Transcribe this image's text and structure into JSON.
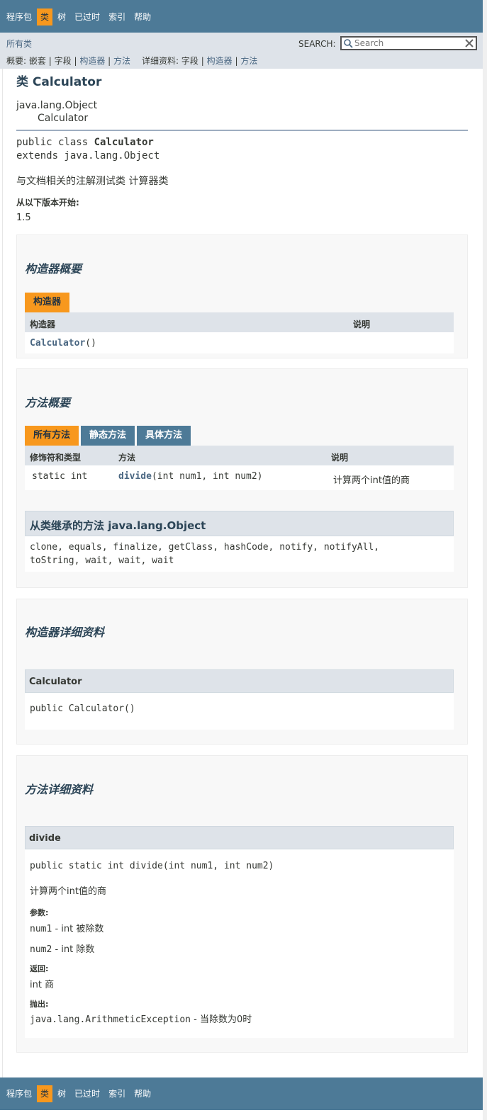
{
  "topnav": {
    "items": [
      {
        "label": "程序包",
        "active": false
      },
      {
        "label": "类",
        "active": true
      },
      {
        "label": "树",
        "active": false
      },
      {
        "label": "已过时",
        "active": false
      },
      {
        "label": "索引",
        "active": false
      },
      {
        "label": "帮助",
        "active": false
      }
    ]
  },
  "subnav": {
    "all_classes": "所有类",
    "search_label": "SEARCH:",
    "search_placeholder": "Search",
    "summary_prefix": "概要:",
    "summary_nested": "嵌套",
    "summary_field": "字段",
    "summary_constr": "构造器",
    "summary_method": "方法",
    "detail_prefix": "详细资料:",
    "detail_field": "字段",
    "detail_constr": "构造器",
    "detail_method": "方法",
    "sep": "|"
  },
  "header": {
    "title": "类 Calculator",
    "inherit_parent": "java.lang.Object",
    "inherit_child": "Calculator",
    "signature_line1_prefix": "public class ",
    "signature_line1_name": "Calculator",
    "signature_line2": "extends java.lang.Object",
    "description": "与文档相关的注解测试类 计算器类",
    "since_label": "从以下版本开始:",
    "since_value": "1.5"
  },
  "constructor_summary": {
    "heading": "构造器概要",
    "tab": "构造器",
    "col_constructor": "构造器",
    "col_desc": "说明",
    "rows": [
      {
        "name": "Calculator",
        "params": "()",
        "desc": ""
      }
    ]
  },
  "method_summary": {
    "heading": "方法概要",
    "tabs": [
      {
        "label": "所有方法",
        "active": true
      },
      {
        "label": "静态方法",
        "active": false
      },
      {
        "label": "具体方法",
        "active": false
      }
    ],
    "col_modifier": "修饰符和类型",
    "col_method": "方法",
    "col_desc": "说明",
    "rows": [
      {
        "modifier": "static int",
        "name": "divide",
        "params": "(int num1, int num2)",
        "desc": "计算两个int值的商"
      }
    ],
    "inherited_heading": "从类继承的方法 java.lang.Object",
    "inherited_line1": "clone, equals, finalize, getClass, hashCode, notify, notifyAll,",
    "inherited_line2": "toString, wait, wait, wait"
  },
  "constructor_detail": {
    "heading": "构造器详细资料",
    "name": "Calculator",
    "signature": "public Calculator()"
  },
  "method_detail": {
    "heading": "方法详细资料",
    "name": "divide",
    "signature": "public static int divide(int num1, int num2)",
    "description": "计算两个int值的商",
    "params_label": "参数:",
    "param1_name": "num1",
    "param1_desc": " - int 被除数",
    "param2_name": "num2",
    "param2_desc": " - int 除数",
    "returns_label": "返回:",
    "returns_value": "int 商",
    "throws_label": "抛出:",
    "throws_name": "java.lang.ArithmeticException",
    "throws_desc": " - 当除数为0时"
  },
  "colors": {
    "nav_bg": "#4d7a97",
    "active_tab": "#f8981d",
    "subnav_bg": "#dee3e9",
    "link": "#4a6782"
  }
}
